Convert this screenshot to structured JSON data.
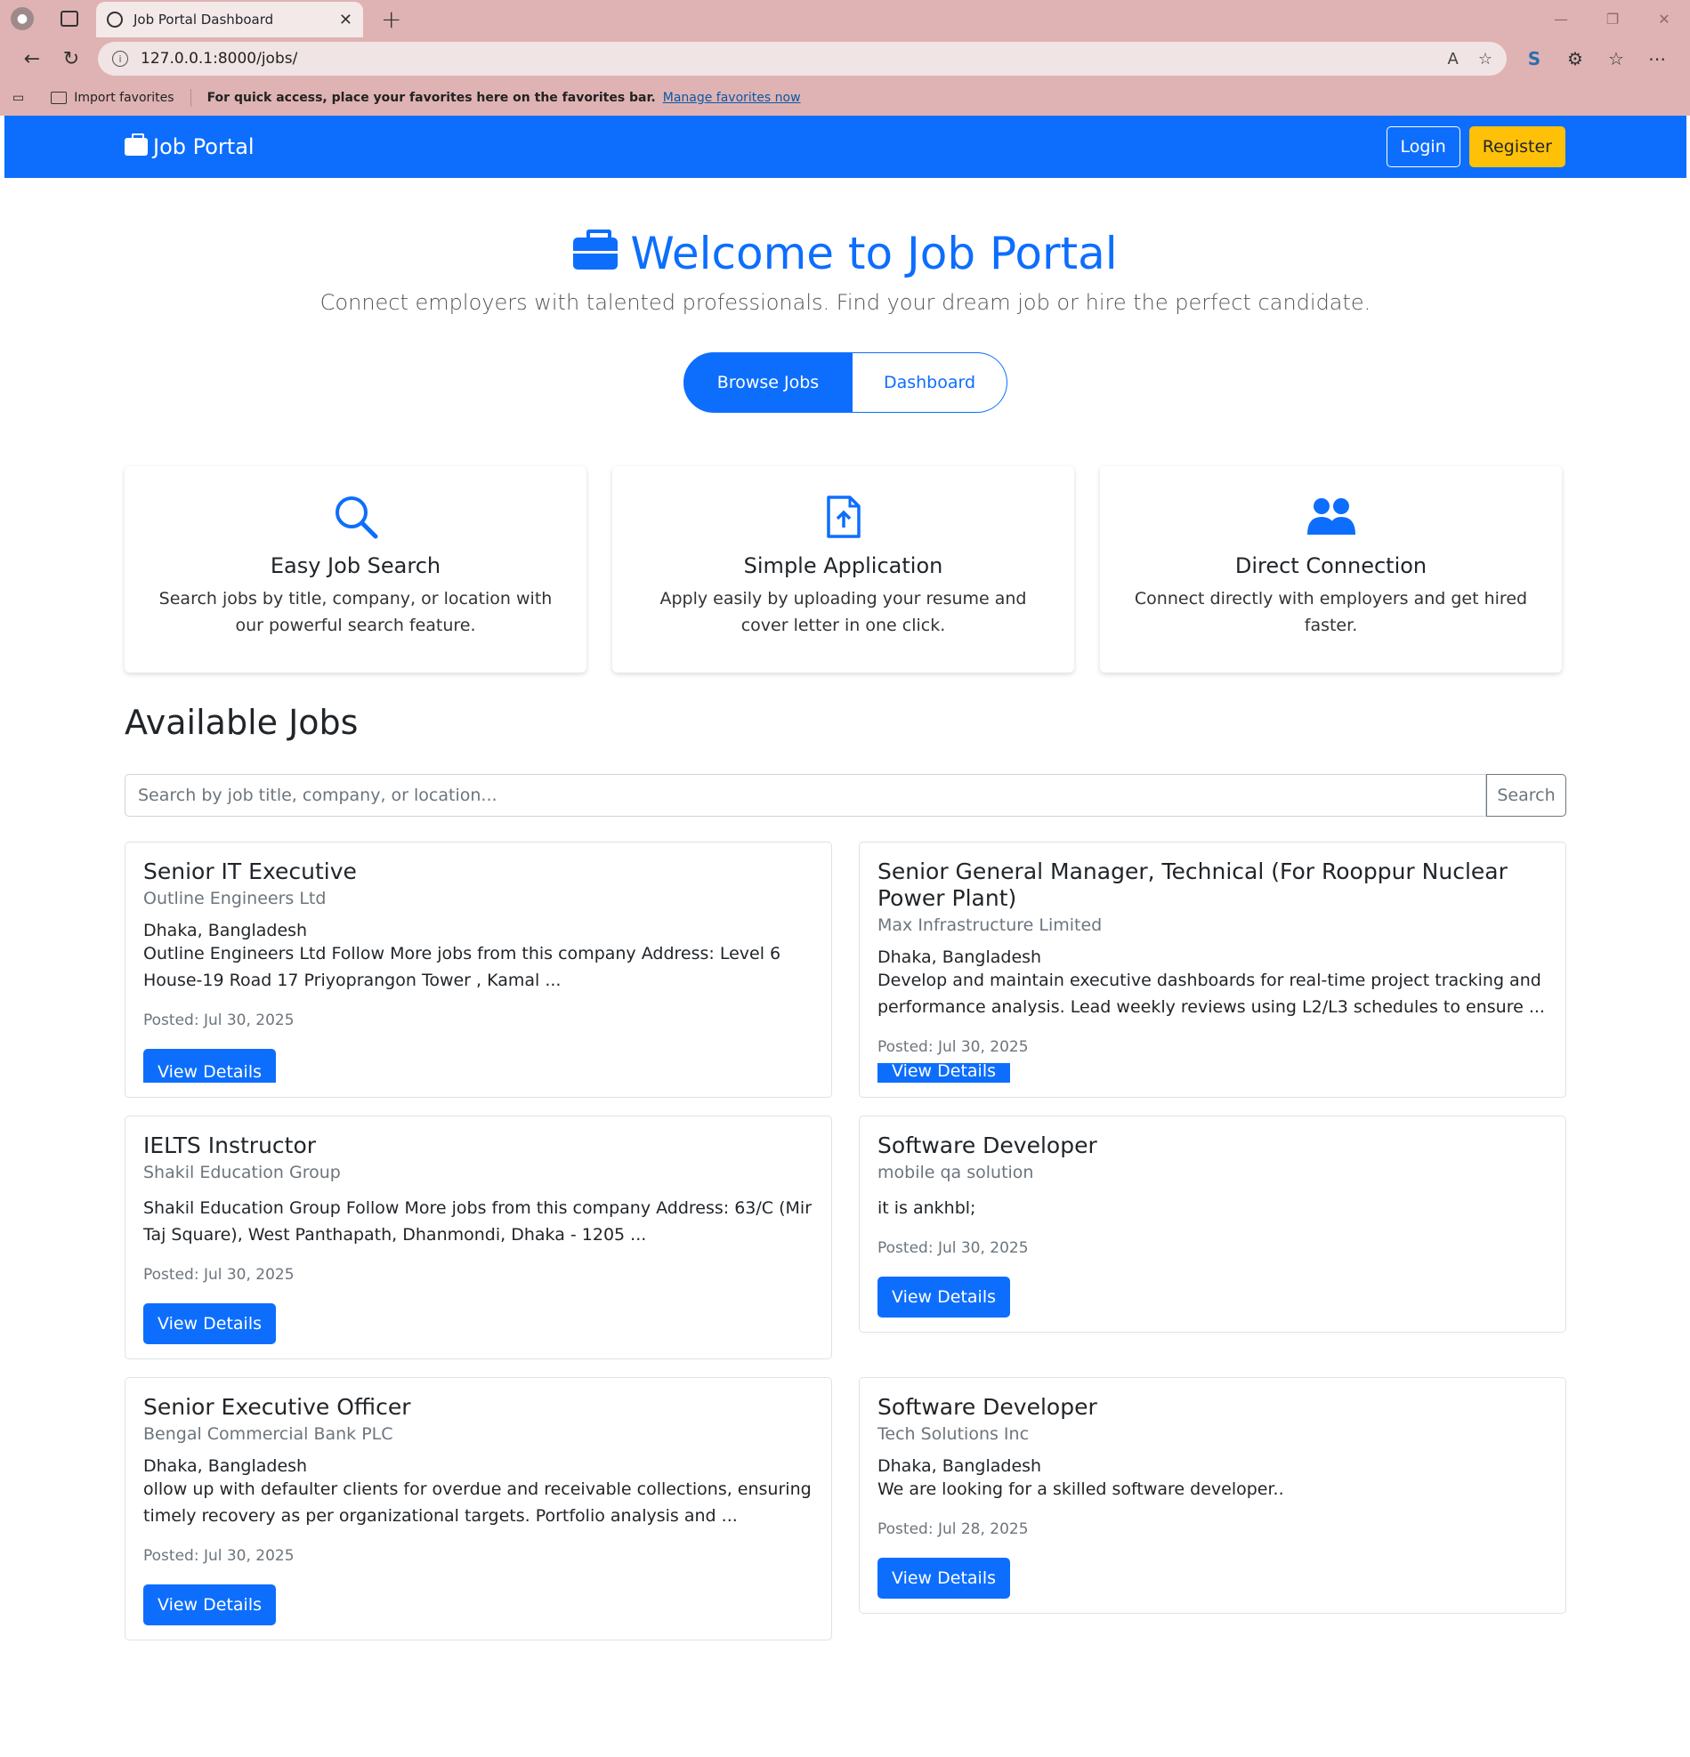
{
  "browser": {
    "tab_title": "Job Portal Dashboard",
    "url": "127.0.0.1:8000/jobs/",
    "favorites": {
      "import_label": "Import favorites",
      "quick_access_text": "For quick access, place your favorites here on the favorites bar.",
      "manage_link": "Manage favorites now"
    }
  },
  "navbar": {
    "brand": "Job Portal",
    "login": "Login",
    "register": "Register"
  },
  "hero": {
    "title": "Welcome to Job Portal",
    "subtitle": "Connect employers with talented professionals. Find your dream job or hire the perfect candidate.",
    "browse_jobs": "Browse Jobs",
    "dashboard": "Dashboard"
  },
  "features": [
    {
      "icon": "search-icon",
      "title": "Easy Job Search",
      "text": "Search jobs by title, company, or location with our powerful search feature."
    },
    {
      "icon": "file-upload-icon",
      "title": "Simple Application",
      "text": "Apply easily by uploading your resume and cover letter in one click."
    },
    {
      "icon": "people-icon",
      "title": "Direct Connection",
      "text": "Connect directly with employers and get hired faster."
    }
  ],
  "jobs_section": {
    "heading": "Available Jobs",
    "search_placeholder": "Search by job title, company, or location...",
    "search_button": "Search",
    "view_details": "View Details",
    "jobs": [
      {
        "title": "Senior IT Executive",
        "company": "Outline Engineers Ltd",
        "location": "Dhaka, Bangladesh",
        "description": "Outline Engineers Ltd Follow More jobs from this company Address: Level 6 House-19 Road 17 Priyoprangon Tower , Kamal ...",
        "posted": "Posted: Jul 30, 2025"
      },
      {
        "title": "Senior General Manager, Technical (For Rooppur Nuclear Power Plant)",
        "company": "Max Infrastructure Limited",
        "location": "Dhaka, Bangladesh",
        "description": "Develop and maintain executive dashboards for real-time project tracking and performance analysis. Lead weekly reviews using L2/L3 schedules to ensure ...",
        "posted": "Posted: Jul 30, 2025"
      },
      {
        "title": "IELTS Instructor",
        "company": "Shakil Education Group",
        "location": "",
        "description": "Shakil Education Group Follow More jobs from this company Address: 63/C (Mir Taj Square), West Panthapath, Dhanmondi, Dhaka - 1205 ...",
        "posted": "Posted: Jul 30, 2025"
      },
      {
        "title": "Software Developer",
        "company": "mobile qa solution",
        "location": "",
        "description": "it is ankhbl;",
        "posted": "Posted: Jul 30, 2025"
      },
      {
        "title": "Senior Executive Officer",
        "company": "Bengal Commercial Bank PLC",
        "location": "Dhaka, Bangladesh",
        "description": "ollow up with defaulter clients for overdue and receivable collections, ensuring timely recovery as per organizational targets. Portfolio analysis and ...",
        "posted": "Posted: Jul 30, 2025"
      },
      {
        "title": "Software Developer",
        "company": "Tech Solutions Inc",
        "location": "Dhaka, Bangladesh",
        "description": "We are looking for a skilled software developer..",
        "posted": "Posted: Jul 28, 2025"
      }
    ]
  },
  "colors": {
    "primary": "#0d6efd",
    "warning": "#ffc107",
    "chrome": "#dfb3b3",
    "muted": "#6c757d"
  }
}
